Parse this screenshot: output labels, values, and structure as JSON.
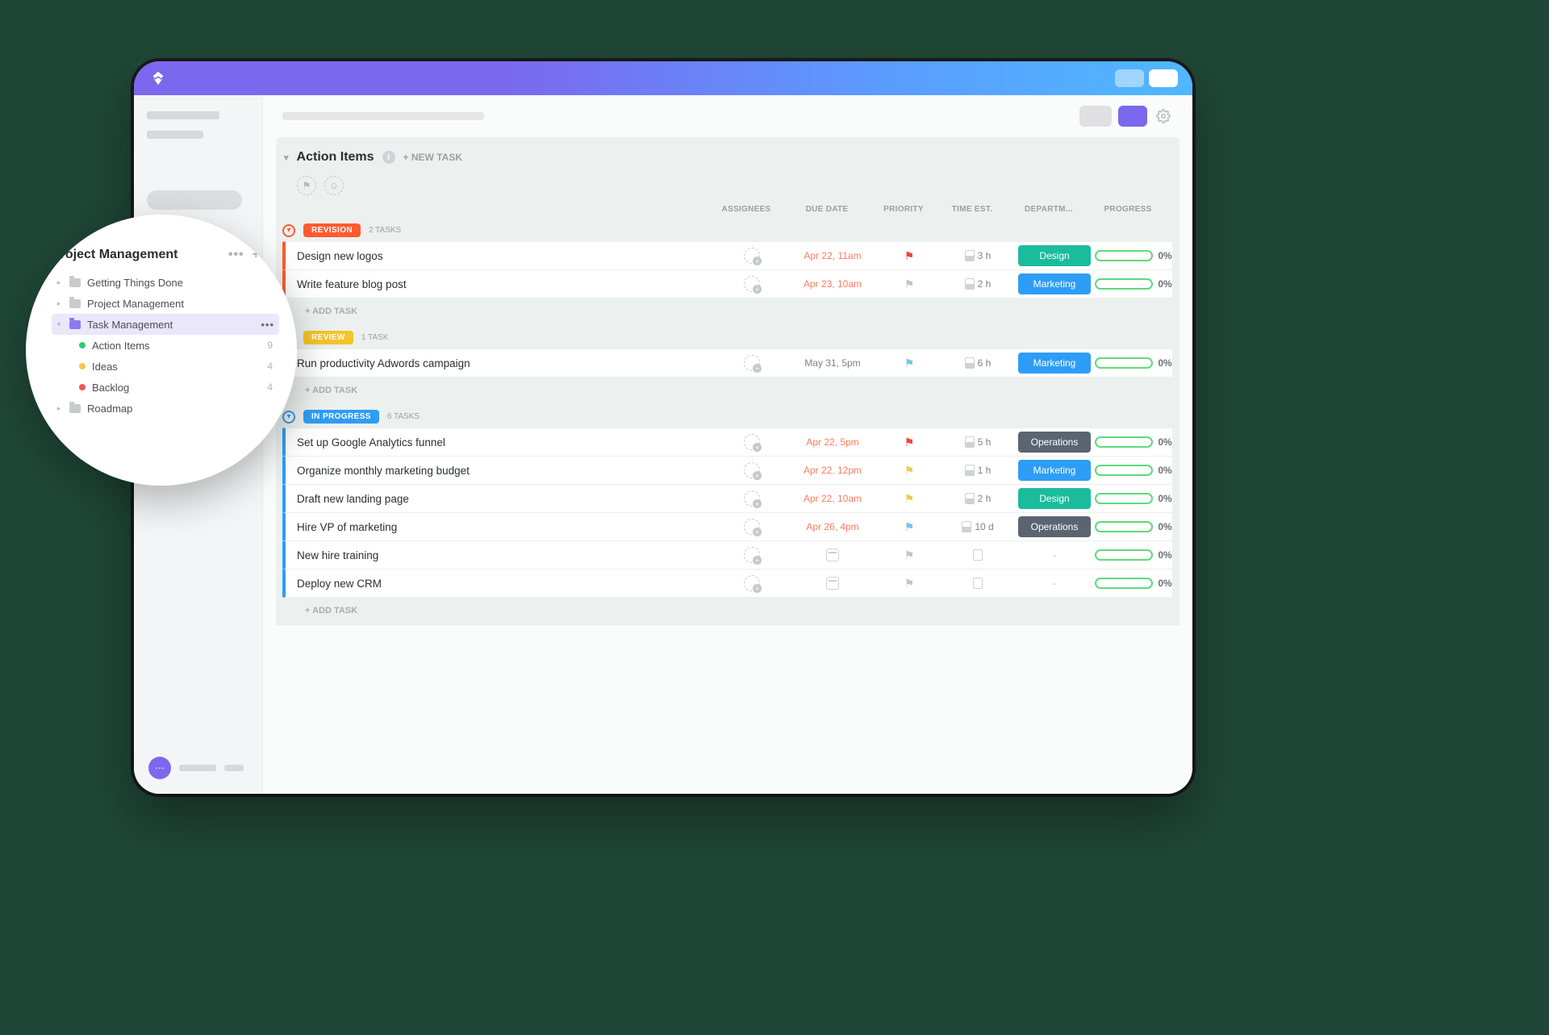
{
  "list": {
    "title": "Action Items",
    "new_task": "+ NEW TASK",
    "add_task": "+ ADD TASK",
    "columns": {
      "assignees": "ASSIGNEES",
      "due": "DUE DATE",
      "priority": "PRIORITY",
      "time": "TIME EST.",
      "dept": "DEPARTM...",
      "progress": "PROGRESS"
    }
  },
  "groups": [
    {
      "name": "REVISION",
      "count": "2 TASKS",
      "tasks": [
        {
          "title": "Design new logos",
          "due": "Apr 22, 11am",
          "due_cls": "red",
          "flag": "f-red",
          "time": "3 h",
          "tag": "Design",
          "tag_cls": "design",
          "prog": "0%"
        },
        {
          "title": "Write feature blog post",
          "due": "Apr 23, 10am",
          "due_cls": "red",
          "flag": "f-gray",
          "time": "2 h",
          "tag": "Marketing",
          "tag_cls": "marketing",
          "prog": "0%"
        }
      ]
    },
    {
      "name": "REVIEW",
      "count": "1 TASK",
      "tasks": [
        {
          "title": "Run productivity Adwords campaign",
          "due": "May 31, 5pm",
          "due_cls": "gray",
          "flag": "f-blue",
          "time": "6 h",
          "tag": "Marketing",
          "tag_cls": "marketing",
          "prog": "0%"
        }
      ]
    },
    {
      "name": "IN PROGRESS",
      "count": "6 TASKS",
      "tasks": [
        {
          "title": "Set up Google Analytics funnel",
          "due": "Apr 22, 5pm",
          "due_cls": "red",
          "flag": "f-red",
          "time": "5 h",
          "tag": "Operations",
          "tag_cls": "ops",
          "prog": "0%"
        },
        {
          "title": "Organize monthly marketing budget",
          "due": "Apr 22, 12pm",
          "due_cls": "red",
          "flag": "f-yellow",
          "time": "1 h",
          "tag": "Marketing",
          "tag_cls": "marketing",
          "prog": "0%"
        },
        {
          "title": "Draft new landing page",
          "due": "Apr 22, 10am",
          "due_cls": "red",
          "flag": "f-yellow",
          "time": "2 h",
          "tag": "Design",
          "tag_cls": "design",
          "prog": "0%"
        },
        {
          "title": "Hire VP of marketing",
          "due": "Apr 26, 4pm",
          "due_cls": "red",
          "flag": "f-blue",
          "time": "10 d",
          "tag": "Operations",
          "tag_cls": "ops",
          "prog": "0%"
        },
        {
          "title": "New hire training",
          "due": "",
          "flag": "f-gray",
          "time": "",
          "tag": "-",
          "tag_cls": "none",
          "prog": "0%"
        },
        {
          "title": "Deploy new CRM",
          "due": "",
          "flag": "f-gray",
          "time": "",
          "tag": "-",
          "tag_cls": "none",
          "prog": "0%"
        }
      ]
    }
  ],
  "sidebar": {
    "title": "Project Management",
    "items": [
      {
        "label": "Getting Things Done"
      },
      {
        "label": "Project Management"
      },
      {
        "label": "Task Management",
        "selected": true
      },
      {
        "label": "Action Items",
        "count": "9",
        "dot": "d-green"
      },
      {
        "label": "Ideas",
        "count": "4",
        "dot": "d-yellow"
      },
      {
        "label": "Backlog",
        "count": "4",
        "dot": "d-red"
      },
      {
        "label": "Roadmap"
      }
    ]
  }
}
